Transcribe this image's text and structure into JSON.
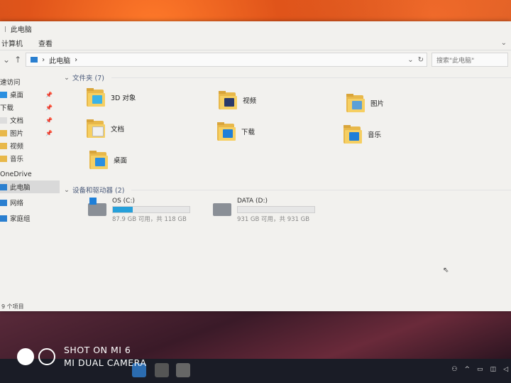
{
  "window": {
    "title": "此电脑"
  },
  "ribbon": {
    "tabs": [
      "计算机",
      "查看"
    ]
  },
  "address": {
    "path": "此电脑",
    "separator": "›",
    "search_placeholder": "搜索\"此电脑\""
  },
  "sidebar": {
    "items": [
      {
        "label": "速访问"
      },
      {
        "label": "桌面"
      },
      {
        "label": "下载"
      },
      {
        "label": "文档"
      },
      {
        "label": "图片"
      },
      {
        "label": "视频"
      },
      {
        "label": "音乐"
      },
      {
        "label": "OneDrive"
      },
      {
        "label": "此电脑"
      },
      {
        "label": "网络"
      },
      {
        "label": "家庭组"
      }
    ]
  },
  "sections": {
    "folders": "文件夹 (7)",
    "drives": "设备和驱动器 (2)"
  },
  "folders": [
    {
      "label": "3D 对象",
      "badge_color": "#3bb3e6"
    },
    {
      "label": "视频",
      "badge_color": "#2a3a6a"
    },
    {
      "label": "图片",
      "badge_color": "#5aa0d8"
    },
    {
      "label": "文档",
      "badge_color": "#f0f0f0"
    },
    {
      "label": "下载",
      "badge_color": "#1e7fd8"
    },
    {
      "label": "音乐",
      "badge_color": "#1e7fd8"
    },
    {
      "label": "桌面",
      "badge_color": "#2a8fe0"
    }
  ],
  "drives": [
    {
      "name": "OS (C:)",
      "free_text": "87.9 GB 可用，共 118 GB",
      "used_fraction": 0.26
    },
    {
      "name": "DATA (D:)",
      "free_text": "931 GB 可用，共 931 GB",
      "used_fraction": 0.0
    }
  ],
  "status": {
    "items": "9 个项目"
  },
  "watermark": {
    "line1": "SHOT ON MI 6",
    "line2": "MI DUAL CAMERA"
  }
}
